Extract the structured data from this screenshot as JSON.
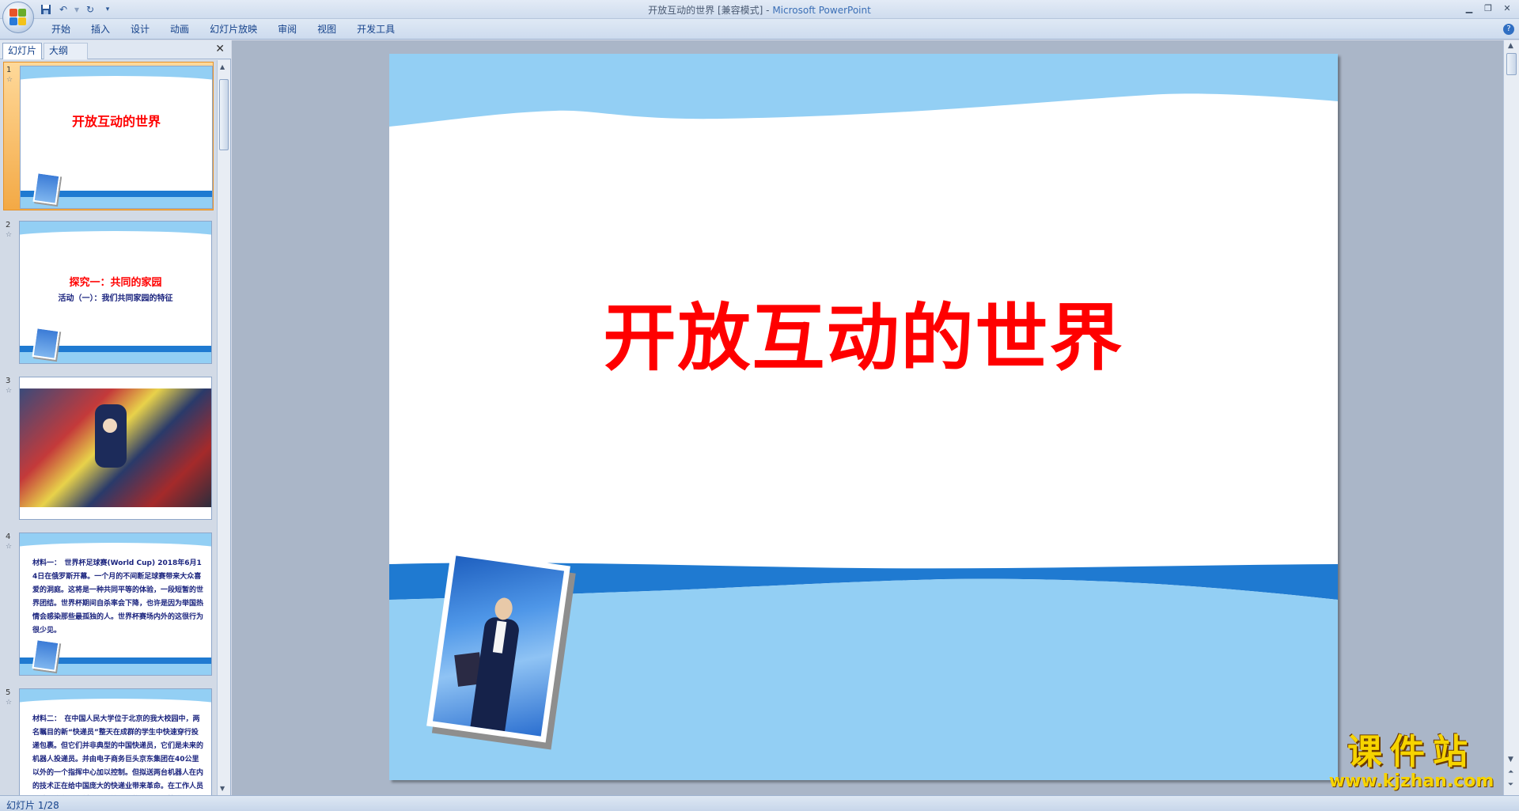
{
  "window": {
    "title": "开放互动的世界 [兼容模式]",
    "app_name": "Microsoft PowerPoint",
    "separator": " - "
  },
  "quick_access": {
    "save_icon": "save-icon",
    "undo_icon": "undo-icon",
    "redo_icon": "redo-icon",
    "customize_icon": "dropdown-arrow-icon"
  },
  "ribbon": {
    "tabs": [
      "开始",
      "插入",
      "设计",
      "动画",
      "幻灯片放映",
      "审阅",
      "视图",
      "开发工具"
    ]
  },
  "left_panel": {
    "tab_slides": "幻灯片",
    "tab_outline": "大纲",
    "close": "✕"
  },
  "thumbnails": [
    {
      "num": "1",
      "title": "开放互动的世界"
    },
    {
      "num": "2",
      "title": "探究一：共同的家园",
      "subtitle": "活动（一）：我们共同家园的特征"
    },
    {
      "num": "3"
    },
    {
      "num": "4",
      "text": "材料一：　世界杯足球赛(World Cup) 2018年6月14日在俄罗斯开幕。一个月的不间断足球赛带来大众喜爱的洞庭。这将是一种共同平等的体验，一段短暂的世界团结。世界杯期间自杀率会下降，也许是因为举国热情会感染那些最孤独的人。世界杯赛场内外的这很行为很少见。"
    },
    {
      "num": "5",
      "text": "材料二：　在中国人民大学位于北京的我大校园中，两名瞩目的新“快递员”整天在成群的学生中快速穿行投递包裹。但它们并非典型的中国快递员，它们是未来的机器人投递员。并由电子商务巨头京东集团在40公里以外的一个指挥中心加以控制。但拟送两台机器人在内的技术正在给中国庞大的快递业带来革命。在工作人员帮助，商务委和村民代表签下建的背景下，快递业正"
    }
  ],
  "slide": {
    "title": "开放互动的世界"
  },
  "status": {
    "slide_indicator": "幻灯片 1/28"
  },
  "watermark": {
    "name": "课件站",
    "url": "www.kjzhan.com"
  },
  "colors": {
    "title_red": "#ff0000",
    "wave_light": "#93cff4",
    "band_blue": "#1f7ad1",
    "selected_orange": "#f3a945"
  }
}
